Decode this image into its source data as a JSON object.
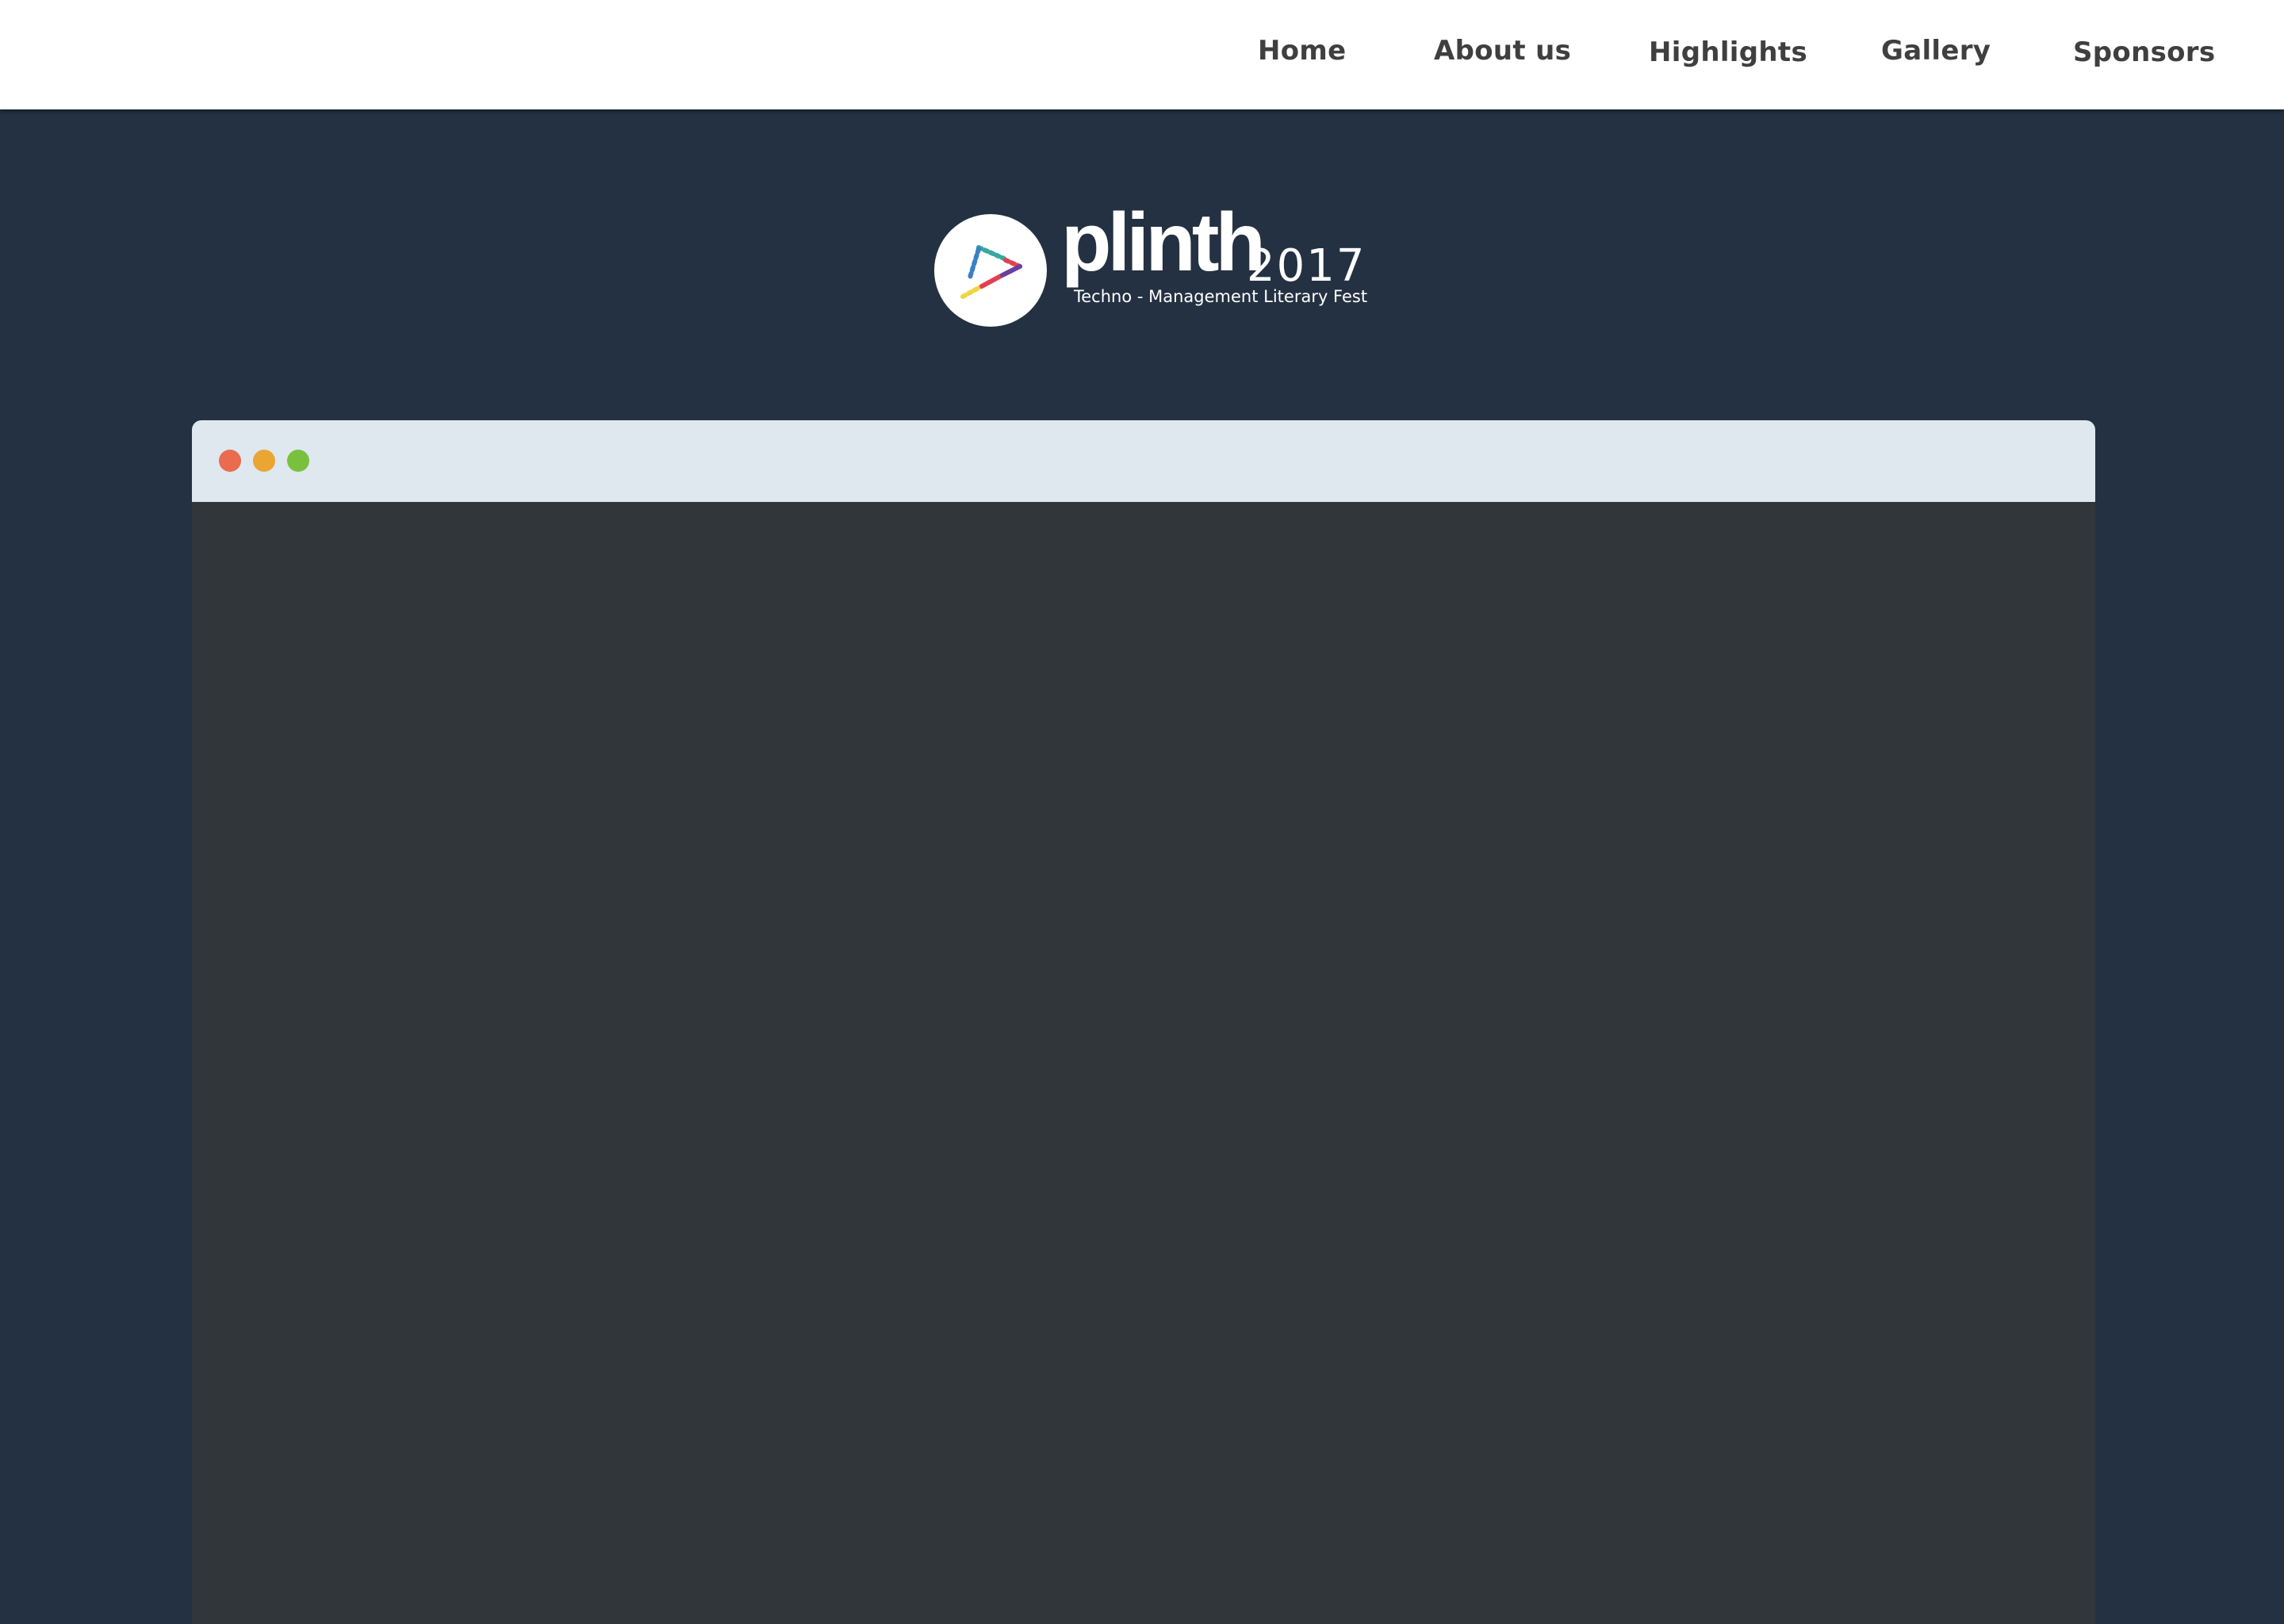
{
  "nav": {
    "items": [
      {
        "label": "Home"
      },
      {
        "label": "About us"
      },
      {
        "label": "Highlights"
      },
      {
        "label": "Gallery"
      },
      {
        "label": "Sponsors"
      }
    ]
  },
  "logo": {
    "name": "plinth",
    "year": "2017",
    "tagline": "Techno - Management Literary Fest"
  },
  "window": {
    "controls": [
      "close",
      "minimize",
      "maximize"
    ]
  },
  "colors": {
    "page_background": "#243142",
    "navbar_background": "#ffffff",
    "nav_text": "#3f3f3f",
    "window_bar": "#dfe7ef",
    "window_body": "#31363b",
    "close_dot": "#ea6b4e",
    "minimize_dot": "#eaa533",
    "maximize_dot": "#7ac03f"
  }
}
